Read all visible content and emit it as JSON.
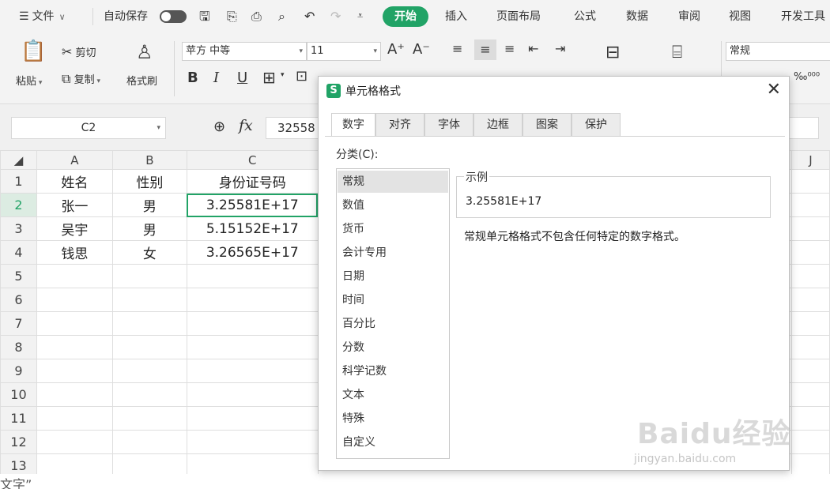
{
  "menu": {
    "file": "文件",
    "autosave": "自动保存",
    "tabs": [
      "开始",
      "插入",
      "页面布局",
      "公式",
      "数据",
      "审阅",
      "视图",
      "开发工具"
    ]
  },
  "ribbon": {
    "paste": "粘贴",
    "cut": "剪切",
    "copy": "复制",
    "format_painter": "格式刷",
    "font_name": "苹方 中等",
    "font_size": "11",
    "number_format": "常规",
    "bold": "B",
    "italic": "I",
    "underline": "U"
  },
  "formula_bar": {
    "name_box": "C2",
    "fx": "fx",
    "value": "32558"
  },
  "sheet": {
    "columns": [
      "A",
      "B",
      "C",
      "J"
    ],
    "rows": [
      "1",
      "2",
      "3",
      "4",
      "5",
      "6",
      "7",
      "8",
      "9",
      "10",
      "11",
      "12",
      "13"
    ],
    "header_row": [
      "姓名",
      "性别",
      "身份证号码"
    ],
    "data": [
      [
        "张一",
        "男",
        "3.25581E+17"
      ],
      [
        "吴宇",
        "男",
        "5.15152E+17"
      ],
      [
        "钱思",
        "女",
        "3.26565E+17"
      ]
    ]
  },
  "dialog": {
    "title": "单元格格式",
    "tabs": [
      "数字",
      "对齐",
      "字体",
      "边框",
      "图案",
      "保护"
    ],
    "category_label": "分类(C):",
    "categories": [
      "常规",
      "数值",
      "货币",
      "会计专用",
      "日期",
      "时间",
      "百分比",
      "分数",
      "科学记数",
      "文本",
      "特殊",
      "自定义"
    ],
    "sample_label": "示例",
    "sample_value": "3.25581E+17",
    "description": "常规单元格格式不包含任何特定的数字格式。"
  },
  "bottom_text": "文字”",
  "watermark": {
    "brand": "Baidu经验",
    "url": "jingyan.baidu.com"
  },
  "colors": {
    "accent": "#21a366",
    "selection_fill": "#dcece2"
  }
}
